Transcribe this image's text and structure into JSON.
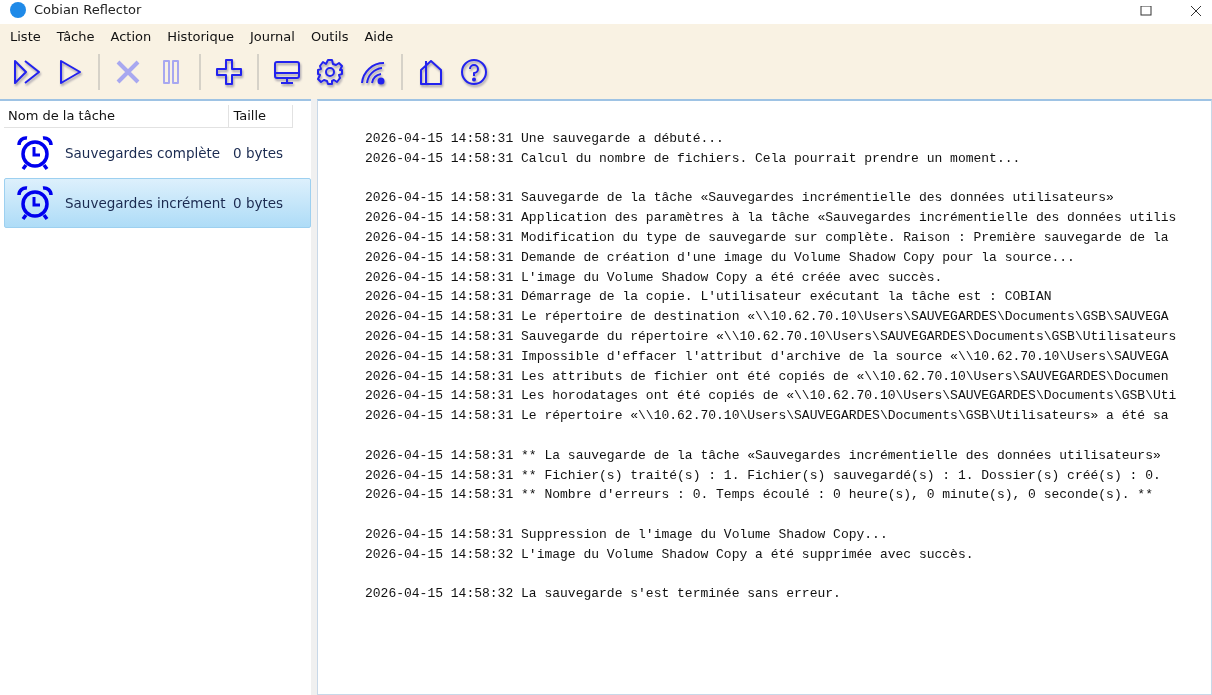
{
  "window": {
    "title": "Cobian Reflector"
  },
  "menu": [
    "Liste",
    "Tâche",
    "Action",
    "Historique",
    "Journal",
    "Outils",
    "Aide"
  ],
  "toolbar": [
    {
      "kind": "run-all",
      "disabled": false
    },
    {
      "kind": "run",
      "disabled": false
    },
    {
      "kind": "sep"
    },
    {
      "kind": "cancel",
      "disabled": true
    },
    {
      "kind": "pause",
      "disabled": true
    },
    {
      "kind": "sep"
    },
    {
      "kind": "add",
      "disabled": false
    },
    {
      "kind": "sep"
    },
    {
      "kind": "monitor",
      "disabled": false
    },
    {
      "kind": "settings",
      "disabled": false
    },
    {
      "kind": "signal",
      "disabled": false
    },
    {
      "kind": "sep"
    },
    {
      "kind": "home",
      "disabled": false
    },
    {
      "kind": "help",
      "disabled": false
    }
  ],
  "tasks": {
    "columns": [
      "Nom de la tâche",
      "Taille"
    ],
    "rows": [
      {
        "name": "Sauvegardes complète",
        "size": "0 bytes",
        "selected": false
      },
      {
        "name": "Sauvegardes incrément",
        "size": "0 bytes",
        "selected": true
      }
    ]
  },
  "log": [
    [
      "2026-04-15 14:58:31 Une sauvegarde a débuté...",
      "2026-04-15 14:58:31 Calcul du nombre de fichiers. Cela pourrait prendre un moment..."
    ],
    [
      "2026-04-15 14:58:31 Sauvegarde de la tâche «Sauvegardes incrémentielle des données utilisateurs»",
      "2026-04-15 14:58:31 Application des paramètres à la tâche «Sauvegardes incrémentielle des données utilis",
      "2026-04-15 14:58:31 Modification du type de sauvegarde sur complète. Raison : Première sauvegarde de la",
      "2026-04-15 14:58:31 Demande de création d'une image du Volume Shadow Copy pour la source...",
      "2026-04-15 14:58:31 L'image du Volume Shadow Copy a été créée avec succès.",
      "2026-04-15 14:58:31 Démarrage de la copie. L'utilisateur exécutant la tâche est : COBIAN",
      "2026-04-15 14:58:31 Le répertoire de destination «\\\\10.62.70.10\\Users\\SAUVEGARDES\\Documents\\GSB\\SAUVEGA",
      "2026-04-15 14:58:31 Sauvegarde du répertoire «\\\\10.62.70.10\\Users\\SAUVEGARDES\\Documents\\GSB\\Utilisateurs",
      "2026-04-15 14:58:31 Impossible d'effacer l'attribut d'archive de la source «\\\\10.62.70.10\\Users\\SAUVEGA",
      "2026-04-15 14:58:31 Les attributs de fichier ont été copiés de «\\\\10.62.70.10\\Users\\SAUVEGARDES\\Documen",
      "2026-04-15 14:58:31 Les horodatages ont été copiés de «\\\\10.62.70.10\\Users\\SAUVEGARDES\\Documents\\GSB\\Uti",
      "2026-04-15 14:58:31 Le répertoire «\\\\10.62.70.10\\Users\\SAUVEGARDES\\Documents\\GSB\\Utilisateurs» a été sa"
    ],
    [
      "2026-04-15 14:58:31 ** La sauvegarde de la tâche «Sauvegardes incrémentielle des données utilisateurs»",
      "2026-04-15 14:58:31 ** Fichier(s) traité(s) : 1. Fichier(s) sauvegardé(s) : 1. Dossier(s) créé(s) : 0.",
      "2026-04-15 14:58:31 ** Nombre d'erreurs : 0. Temps écoulé : 0 heure(s), 0 minute(s), 0 seconde(s). **"
    ],
    [
      "2026-04-15 14:58:31 Suppression de l'image du Volume Shadow Copy...",
      "2026-04-15 14:58:32 L'image du Volume Shadow Copy a été supprimée avec succès."
    ],
    [
      "2026-04-15 14:58:32 La sauvegarde s'est terminée sans erreur."
    ]
  ]
}
